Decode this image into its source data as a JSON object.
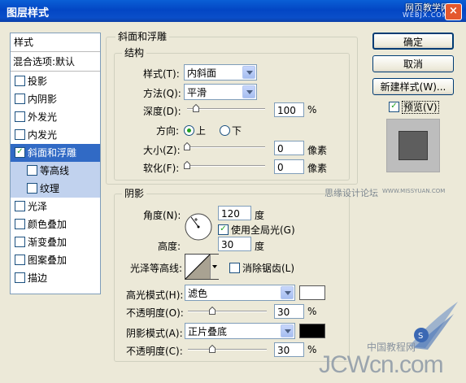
{
  "window": {
    "title": "图层样式",
    "watermark_top": "网页教学网",
    "watermark_top_url": "WEBJX.COM",
    "close_glyph": "×"
  },
  "left_panel": {
    "header": "样式",
    "blend_options": "混合选项:默认",
    "items": [
      {
        "label": "投影",
        "checked": false
      },
      {
        "label": "内阴影",
        "checked": false
      },
      {
        "label": "外发光",
        "checked": false
      },
      {
        "label": "内发光",
        "checked": false
      },
      {
        "label": "斜面和浮雕",
        "checked": true,
        "selected": true
      },
      {
        "label": "等高线",
        "checked": false,
        "sub": true
      },
      {
        "label": "纹理",
        "checked": false,
        "sub": true
      },
      {
        "label": "光泽",
        "checked": false
      },
      {
        "label": "颜色叠加",
        "checked": false
      },
      {
        "label": "渐变叠加",
        "checked": false
      },
      {
        "label": "图案叠加",
        "checked": false
      },
      {
        "label": "描边",
        "checked": false
      }
    ]
  },
  "bevel": {
    "group_title": "斜面和浮雕",
    "structure_title": "结构",
    "style_label": "样式(T):",
    "style_value": "内斜面",
    "technique_label": "方法(Q):",
    "technique_value": "平滑",
    "depth_label": "深度(D):",
    "depth_value": "100",
    "depth_unit": "%",
    "depth_level": 0.1,
    "direction_label": "方向:",
    "direction_up": "上",
    "direction_down": "下",
    "size_label": "大小(Z):",
    "size_value": "0",
    "size_unit": "像素",
    "soften_label": "软化(F):",
    "soften_value": "0",
    "soften_unit": "像素"
  },
  "shading": {
    "title": "阴影",
    "angle_label": "角度(N):",
    "angle_value": "120",
    "angle_unit": "度",
    "global_light_label": "使用全局光(G)",
    "altitude_label": "高度:",
    "altitude_value": "30",
    "altitude_unit": "度",
    "gloss_label": "光泽等高线:",
    "antialias_label": "消除锯齿(L)",
    "highlight_mode_label": "高光模式(H):",
    "highlight_mode_value": "滤色",
    "highlight_color": "#ffffff",
    "highlight_opacity_label": "不透明度(O):",
    "highlight_opacity_value": "30",
    "highlight_opacity_unit": "%",
    "shadow_mode_label": "阴影模式(A):",
    "shadow_mode_value": "正片叠底",
    "shadow_color": "#000000",
    "shadow_opacity_label": "不透明度(C):",
    "shadow_opacity_value": "30",
    "shadow_opacity_unit": "%"
  },
  "buttons": {
    "ok": "确定",
    "cancel": "取消",
    "new_style": "新建样式(W)...",
    "preview": "预览(V)"
  },
  "watermarks": {
    "forum": "思缘设计论坛",
    "forum_url": "WWW.MISSYUAN.COM",
    "bottom": "JCWcn.com",
    "bottom_cn": "中国教程网"
  }
}
